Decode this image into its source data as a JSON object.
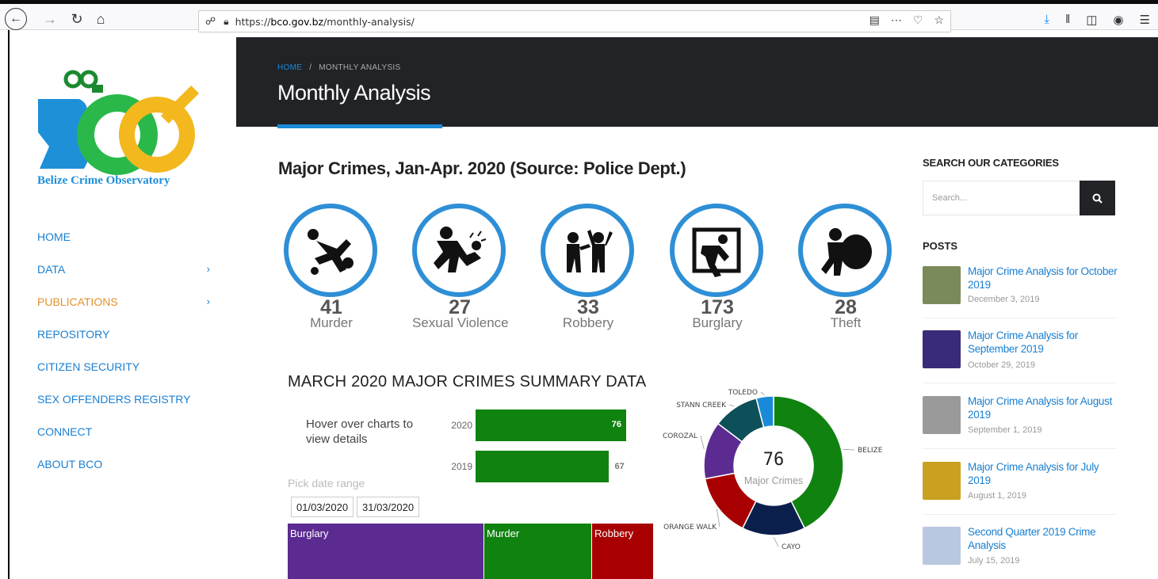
{
  "browser": {
    "url_prefix": "https://",
    "url_domain": "bco.gov.bz",
    "url_path": "/monthly-analysis/"
  },
  "logo": {
    "text": "Belize Crime Observatory"
  },
  "sidebar": {
    "items": [
      {
        "label": "HOME",
        "has_children": false
      },
      {
        "label": "DATA",
        "has_children": true
      },
      {
        "label": "PUBLICATIONS",
        "has_children": true,
        "active": true
      },
      {
        "label": "REPOSITORY",
        "has_children": false
      },
      {
        "label": "CITIZEN SECURITY",
        "has_children": false
      },
      {
        "label": "SEX OFFENDERS REGISTRY",
        "has_children": false
      },
      {
        "label": "CONNECT",
        "has_children": false
      },
      {
        "label": "ABOUT BCO",
        "has_children": false
      }
    ]
  },
  "header": {
    "breadcrumb_home": "HOME",
    "breadcrumb_sep": "/",
    "breadcrumb_current": "MONTHLY ANALYSIS",
    "title": "Monthly Analysis"
  },
  "main": {
    "section_title": "Major Crimes, Jan-Apr. 2020 (Source: Police Dept.)",
    "crimes": [
      {
        "count": "41",
        "label": "Murder",
        "icon": "murder-icon"
      },
      {
        "count": "27",
        "label": "Sexual Violence",
        "icon": "sexual-violence-icon"
      },
      {
        "count": "33",
        "label": "Robbery",
        "icon": "robbery-icon"
      },
      {
        "count": "173",
        "label": "Burglary",
        "icon": "burglary-icon"
      },
      {
        "count": "28",
        "label": "Theft",
        "icon": "theft-icon"
      }
    ],
    "summary_title": "MARCH 2020 MAJOR CRIMES SUMMARY DATA",
    "hover_note": "Hover over charts to view details",
    "pick_label": "Pick date range",
    "date_from": "01/03/2020",
    "date_to": "31/03/2020"
  },
  "chart_data": [
    {
      "type": "bar",
      "categories": [
        "2020",
        "2019"
      ],
      "values": [
        76,
        67
      ],
      "colors": [
        "#108210",
        "#108210"
      ]
    },
    {
      "type": "treemap",
      "categories": [
        "Burglary",
        "Murder",
        "Robbery"
      ],
      "colors": [
        "#5b2b91",
        "#108210",
        "#a80000"
      ]
    },
    {
      "type": "pie",
      "center_value": "76",
      "center_label": "Major Crimes",
      "categories": [
        "BELIZE",
        "CAYO",
        "ORANGE WALK",
        "COROZAL",
        "STANN CREEK",
        "TOLEDO"
      ],
      "values": [
        32,
        11,
        11,
        10,
        8,
        3
      ],
      "colors": [
        "#108210",
        "#0b1f4d",
        "#a80000",
        "#5b2b91",
        "#0d5059",
        "#1a8ad8"
      ]
    }
  ],
  "right_sidebar": {
    "search_title": "SEARCH OUR CATEGORIES",
    "search_placeholder": "Search...",
    "posts_title": "POSTS",
    "posts": [
      {
        "title": "Major Crime Analysis for October 2019",
        "date": "December 3, 2019",
        "thumb_color": "#7a8a5a"
      },
      {
        "title": "Major Crime Analysis for September 2019",
        "date": "October 29, 2019",
        "thumb_color": "#3b2a7a"
      },
      {
        "title": "Major Crime Analysis for August 2019",
        "date": "September 1, 2019",
        "thumb_color": "#9a9a9a"
      },
      {
        "title": "Major Crime Analysis for July 2019",
        "date": "August 1, 2019",
        "thumb_color": "#c9a020"
      },
      {
        "title": "Second Quarter 2019 Crime Analysis",
        "date": "July 15, 2019",
        "thumb_color": "#b8c8e0"
      }
    ]
  }
}
